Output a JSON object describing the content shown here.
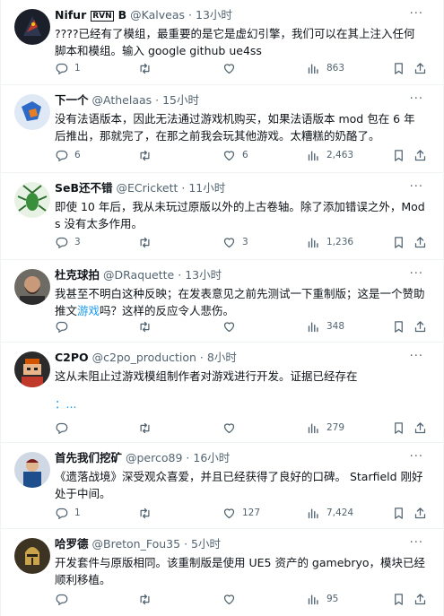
{
  "tweets": [
    {
      "name": "Nifur",
      "badge": "RVN",
      "name_suffix": "B",
      "handle": "@Kalveas",
      "sep": "·",
      "time": "13小时",
      "text": "????已经有了模组，最重要的是它是虚幻引擎，我们可以在其上注入任何脚本和模组。输入 google github ue4ss",
      "replies": "1",
      "retweets": "",
      "likes": "",
      "views": "863",
      "avatar_icon": "dark-bird-avatar"
    },
    {
      "name": "下一个",
      "handle": "@Athelaas",
      "sep": "·",
      "time": "15小时",
      "text": "没有法语版本，因此无法通过游戏机购买，如果法语版本 mod 包在 6 年后推出，那就完了，在那之前我会玩其他游戏。太糟糕的奶酪了。",
      "replies": "6",
      "retweets": "",
      "likes": "6",
      "views": "2,463",
      "avatar_icon": "blue-orange-map-avatar"
    },
    {
      "name": "SeB还不错",
      "handle": "@ECrickett",
      "sep": "·",
      "time": "11小时",
      "text": "即使 10 年后，我从未玩过原版以外的上古卷轴。除了添加错误之外，Mods 没有太多作用。",
      "replies": "3",
      "retweets": "",
      "likes": "3",
      "views": "1,236",
      "avatar_icon": "green-cricket-avatar"
    },
    {
      "name": "杜克球拍",
      "handle": "@DRaquette",
      "sep": "·",
      "time": "13小时",
      "text_before": "我甚至不明白这种反映；在发表意见之前先测试一下重制版；这是一个赞助推文",
      "text_link": "游戏",
      "text_after": "吗？这样的反应令人悲伤。",
      "replies": "",
      "retweets": "",
      "likes": "",
      "views": "348",
      "avatar_icon": "bearded-man-avatar"
    },
    {
      "name": "C2PO",
      "handle": "@c2po_production",
      "sep": "·",
      "time": "8小时",
      "text": "这从未阻止过游戏模组制作者对游戏进行开发。证据已经存在",
      "text_link": "：...",
      "replies": "",
      "retweets": "",
      "likes": "",
      "views": "279",
      "avatar_icon": "pixel-character-avatar"
    },
    {
      "name": "首先我们挖矿",
      "handle": "@perco89",
      "sep": "·",
      "time": "16小时",
      "text": "《遗落战境》深受观众喜爱，并且已经获得了良好的口碑。 Starfield 刚好处于中间。",
      "replies": "1",
      "retweets": "",
      "likes": "127",
      "views": "7,424",
      "avatar_icon": "blue-figure-avatar"
    },
    {
      "name": "哈罗德",
      "handle": "@Breton_Fou35",
      "sep": "·",
      "time": "5小时",
      "text": "开发套件与原版相同。该重制版是使用 UE5 资产的 gamebryo，模块已经顺利移植。",
      "replies": "",
      "retweets": "",
      "likes": "",
      "views": "95",
      "avatar_icon": "knight-helmet-avatar"
    }
  ],
  "ui": {
    "more_glyph": "···",
    "accent": "#1d9bf0",
    "muted": "#536471",
    "text": "#0f1419",
    "border": "#eff3f4"
  }
}
